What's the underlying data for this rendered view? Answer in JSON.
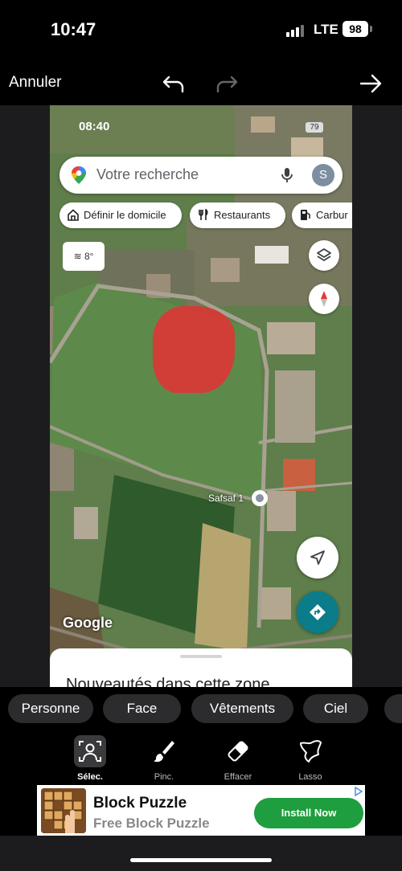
{
  "status_bar": {
    "time": "10:47",
    "network": "LTE",
    "battery": "98"
  },
  "editor_toolbar": {
    "cancel_label": "Annuler",
    "undo_icon": "undo-icon",
    "redo_icon": "redo-icon",
    "next_icon": "arrow-right-icon"
  },
  "map_screen": {
    "status_time": "08:40",
    "status_battery": "79",
    "search_placeholder": "Votre recherche",
    "avatar_letter": "S",
    "chips": [
      {
        "label": "Définir le domicile",
        "icon": "home-icon"
      },
      {
        "label": "Restaurants",
        "icon": "utensils-icon"
      },
      {
        "label": "Carbur",
        "icon": "fuel-icon"
      }
    ],
    "weather": "8°",
    "place_label": "Safsaf 1",
    "google_logo": "Google",
    "sheet_title": "Nouveautés dans cette zone",
    "selection_color": "#d63a36"
  },
  "filters": [
    "Personne",
    "Face",
    "Vêtements",
    "Ciel"
  ],
  "tools": [
    {
      "label": "Sélec.",
      "icon": "select-person-icon",
      "active": true
    },
    {
      "label": "Pinc.",
      "icon": "brush-icon",
      "active": false
    },
    {
      "label": "Effacer",
      "icon": "eraser-icon",
      "active": false
    },
    {
      "label": "Lasso",
      "icon": "lasso-icon",
      "active": false
    }
  ],
  "ad": {
    "title": "Block Puzzle",
    "subtitle": "Free Block Puzzle",
    "button": "Install Now"
  }
}
